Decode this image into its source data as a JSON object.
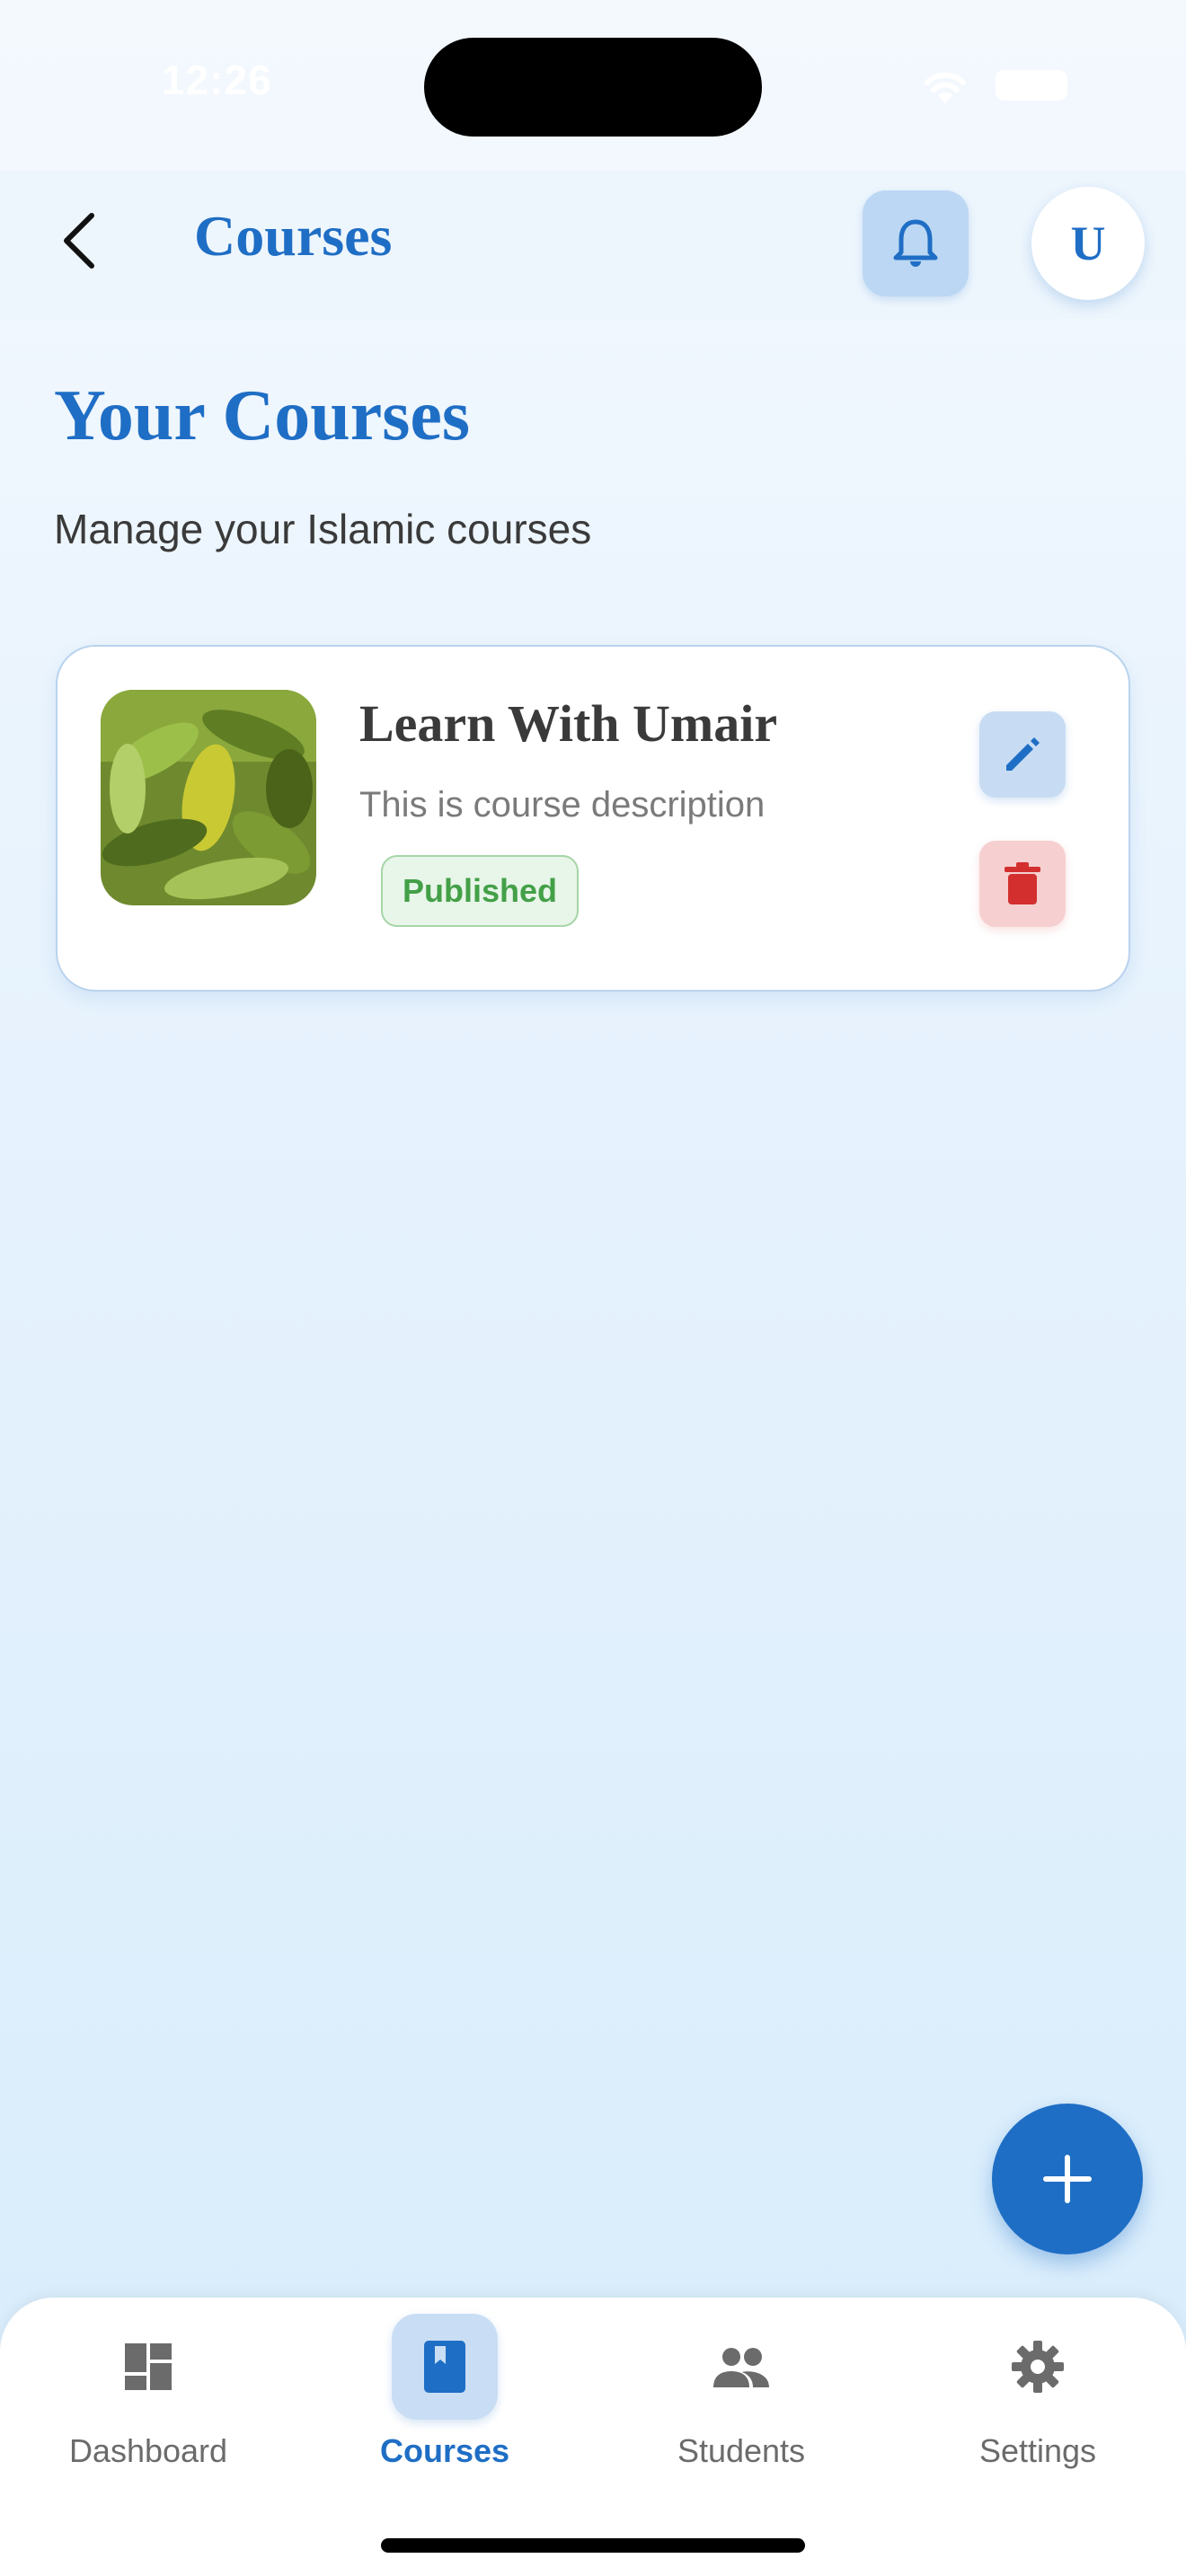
{
  "status_bar": {
    "time": "12:26"
  },
  "app_bar": {
    "title": "Courses",
    "avatar_initial": "U"
  },
  "page": {
    "heading": "Your Courses",
    "subtitle": "Manage your Islamic courses"
  },
  "courses": [
    {
      "title": "Learn With Umair",
      "description": "This is course description",
      "status": "Published"
    }
  ],
  "bottom_nav": {
    "items": [
      {
        "label": "Dashboard",
        "icon": "dashboard-icon",
        "active": false
      },
      {
        "label": "Courses",
        "icon": "book-icon",
        "active": true
      },
      {
        "label": "Students",
        "icon": "people-icon",
        "active": false
      },
      {
        "label": "Settings",
        "icon": "gear-icon",
        "active": false
      }
    ]
  },
  "colors": {
    "primary": "#1f6ec5",
    "published_green": "#43a047",
    "delete_red": "#d32f2f"
  }
}
